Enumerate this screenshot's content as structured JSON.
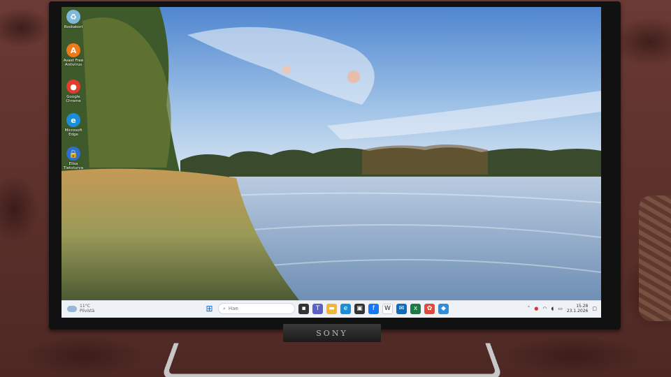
{
  "desktop_icons": [
    {
      "name": "recycle-bin-icon",
      "label": "Roskakori",
      "color": "#7fb8d8",
      "glyph": "♻"
    },
    {
      "name": "avast-icon",
      "label": "Avast Free Antivirus",
      "color": "#f07a18",
      "glyph": "A"
    },
    {
      "name": "chrome-icon",
      "label": "Google Chrome",
      "color": "#e33b2e",
      "glyph": "●"
    },
    {
      "name": "edge-icon",
      "label": "Microsoft Edge",
      "color": "#1a8fd8",
      "glyph": "e"
    },
    {
      "name": "elisa-icon",
      "label": "Elisa Tietoturva",
      "color": "#2f6fd0",
      "glyph": "🔒"
    }
  ],
  "weather": {
    "temp": "11°C",
    "condition": "Pilvistä"
  },
  "search": {
    "placeholder": "Hae"
  },
  "taskbar_apps": [
    {
      "name": "file-icon",
      "color": "#333",
      "glyph": "▪"
    },
    {
      "name": "teams-icon",
      "color": "#5b5fc7",
      "glyph": "T"
    },
    {
      "name": "file-explorer-icon",
      "color": "#f2b53a",
      "glyph": "▬"
    },
    {
      "name": "edge-taskbar-icon",
      "color": "#1a8fd8",
      "glyph": "e"
    },
    {
      "name": "store-icon",
      "color": "#333",
      "glyph": "▣"
    },
    {
      "name": "facebook-icon",
      "color": "#1877f2",
      "glyph": "f"
    },
    {
      "name": "wikipedia-icon",
      "color": "#fff",
      "glyph": "W"
    },
    {
      "name": "outlook-icon",
      "color": "#0f6cbd",
      "glyph": "✉"
    },
    {
      "name": "excel-icon",
      "color": "#1d7a44",
      "glyph": "x"
    },
    {
      "name": "photos-icon",
      "color": "#e04a3a",
      "glyph": "✿"
    },
    {
      "name": "app-icon",
      "color": "#2b8ee0",
      "glyph": "◆"
    }
  ],
  "tray": {
    "time": "15.28",
    "date": "23.1.2026"
  },
  "brand": "SONY"
}
